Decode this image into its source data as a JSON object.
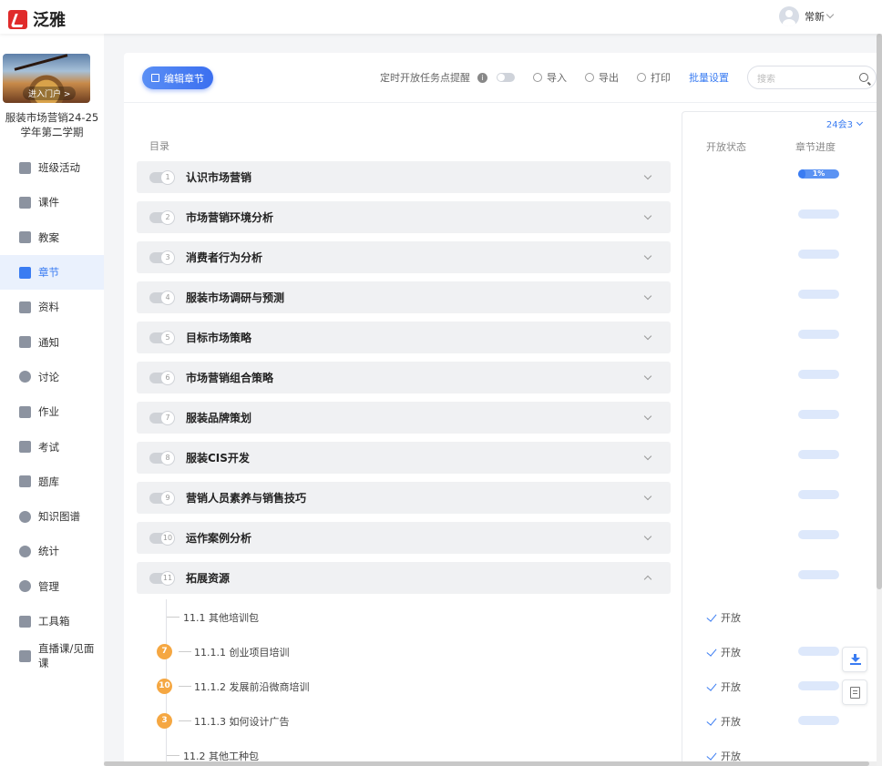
{
  "app": {
    "name": "泛雅"
  },
  "user": {
    "name": "常新"
  },
  "course": {
    "title_line1": "服装市场营销24-25",
    "title_line2": "学年第二学期",
    "portal_label": "进入门户 >"
  },
  "nav": [
    {
      "label": "班级活动",
      "icon": "grid-icon"
    },
    {
      "label": "课件",
      "icon": "courseware-icon"
    },
    {
      "label": "教案",
      "icon": "lesson-plan-icon"
    },
    {
      "label": "章节",
      "icon": "chapter-icon"
    },
    {
      "label": "资料",
      "icon": "folder-icon"
    },
    {
      "label": "通知",
      "icon": "speaker-icon"
    },
    {
      "label": "讨论",
      "icon": "chat-icon"
    },
    {
      "label": "作业",
      "icon": "homework-icon"
    },
    {
      "label": "考试",
      "icon": "exam-icon"
    },
    {
      "label": "题库",
      "icon": "question-bank-icon"
    },
    {
      "label": "知识图谱",
      "icon": "knowledge-graph-icon"
    },
    {
      "label": "统计",
      "icon": "pie-chart-icon"
    },
    {
      "label": "管理",
      "icon": "gear-icon"
    },
    {
      "label": "工具箱",
      "icon": "toolbox-icon"
    },
    {
      "label": "直播课/见面课",
      "icon": "live-icon"
    }
  ],
  "toolbar": {
    "edit_label": "编辑章节",
    "schedule_label": "定时开放任务点提醒",
    "import_label": "导入",
    "export_label": "导出",
    "print_label": "打印",
    "batch_label": "批量设置",
    "search_placeholder": "搜索"
  },
  "directory_label": "目录",
  "side_panel": {
    "class_selector": "24会3",
    "col_open": "开放状态",
    "col_progress": "章节进度"
  },
  "chapters": [
    {
      "num": "1",
      "title": "认识市场营销"
    },
    {
      "num": "2",
      "title": "市场营销环境分析"
    },
    {
      "num": "3",
      "title": "消费者行为分析"
    },
    {
      "num": "4",
      "title": "服装市场调研与预测"
    },
    {
      "num": "5",
      "title": "目标市场策略"
    },
    {
      "num": "6",
      "title": "市场营销组合策略"
    },
    {
      "num": "7",
      "title": "服装品牌策划"
    },
    {
      "num": "8",
      "title": "服装CIS开发"
    },
    {
      "num": "9",
      "title": "营销人员素养与销售技巧"
    },
    {
      "num": "10",
      "title": "运作案例分析"
    },
    {
      "num": "11",
      "title": "拓展资源"
    }
  ],
  "first_progress": {
    "text": "1%",
    "value": 0.01
  },
  "subsections": [
    {
      "title": "11.1 其他培训包",
      "status": "开放"
    },
    {
      "title": "11.1.1 创业项目培训",
      "badge": "7",
      "status": "开放"
    },
    {
      "title": "11.1.2 发展前沿微商培训",
      "badge": "10",
      "status": "开放"
    },
    {
      "title": "11.1.3 如何设计广告",
      "badge": "3",
      "status": "开放"
    },
    {
      "title": "11.2 其他工种包",
      "status": "开放"
    }
  ]
}
